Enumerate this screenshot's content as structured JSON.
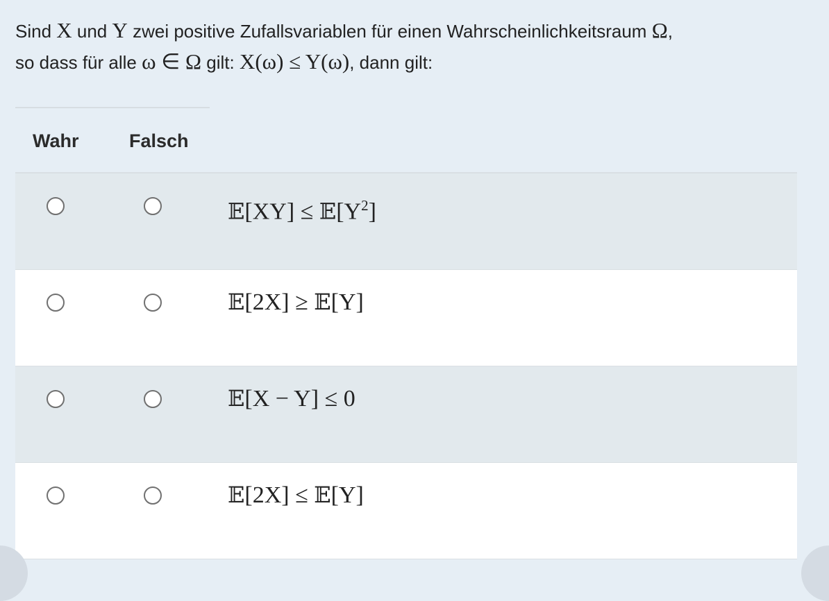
{
  "question": {
    "t1": "Sind ",
    "x": "X",
    "t2": " und ",
    "y": "Y",
    "t3": " zwei positive Zufallsvariablen für einen Wahrscheinlichkeitsraum ",
    "omega": "Ω",
    "t4": ",",
    "t5": "so dass für alle ",
    "cond1": "ω ∈ Ω",
    "t6": " gilt: ",
    "cond2": "X(ω) ≤ Y(ω)",
    "t7": ", dann gilt:"
  },
  "table": {
    "col_true": "Wahr",
    "col_false": "Falsch",
    "rows": [
      {
        "e1": "𝔼",
        "s1": "[XY] ≤ ",
        "e2": "𝔼",
        "s2": "[Y",
        "sup": "2",
        "s3": "]"
      },
      {
        "e1": "𝔼",
        "s1": "[2X] ≥ ",
        "e2": "𝔼",
        "s2": "[Y]"
      },
      {
        "e1": "𝔼",
        "s1": "[X − Y] ≤ 0"
      },
      {
        "e1": "𝔼",
        "s1": "[2X] ≤ ",
        "e2": "𝔼",
        "s2": "[Y]"
      }
    ]
  }
}
